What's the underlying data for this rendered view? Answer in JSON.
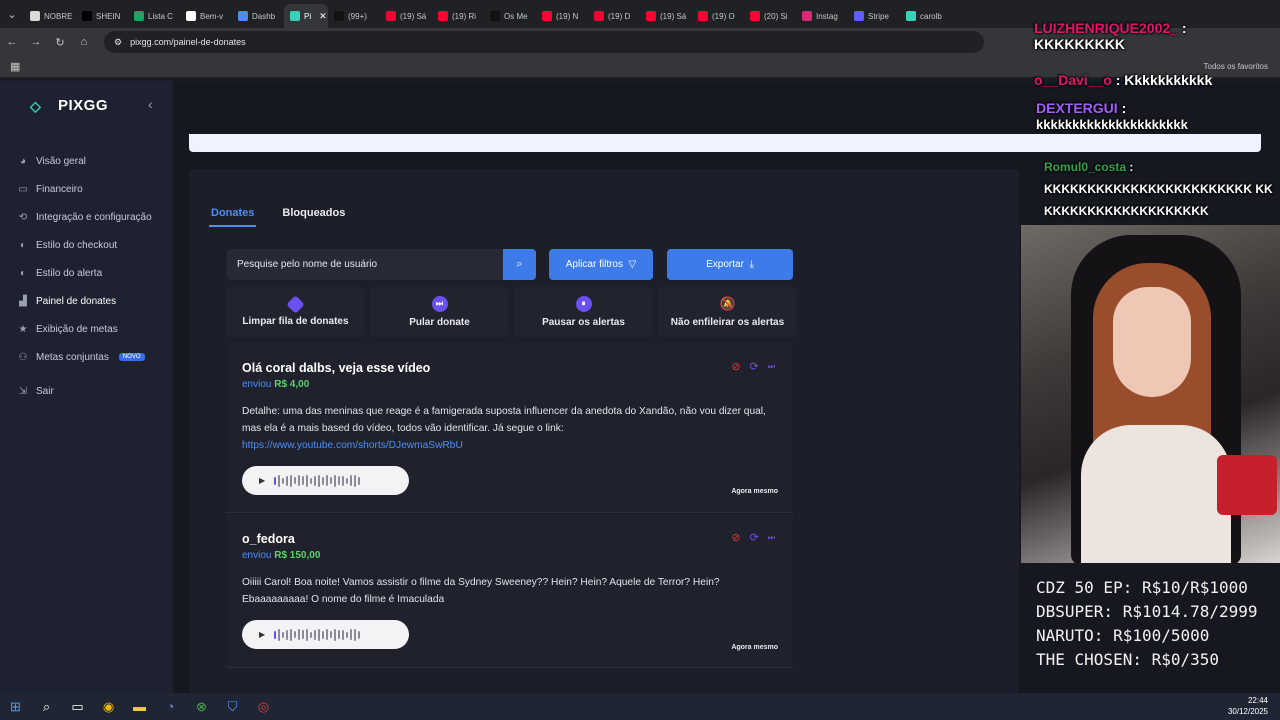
{
  "browser": {
    "tabs": [
      {
        "label": "NOBRE",
        "color": "#d9d9d9"
      },
      {
        "label": "SHEIN",
        "color": "#000000"
      },
      {
        "label": "Lista C",
        "color": "#1fa463"
      },
      {
        "label": "Bem-v",
        "color": "#ffffff"
      },
      {
        "label": "Dashb",
        "color": "#4f8df5"
      },
      {
        "label": "Pi",
        "color": "#3ad1b9",
        "active": true
      },
      {
        "label": "(99+)",
        "color": "#111111"
      },
      {
        "label": "(19) Sá",
        "color": "#ff0033"
      },
      {
        "label": "(19) Ri",
        "color": "#ff0033"
      },
      {
        "label": "Os Me",
        "color": "#111111"
      },
      {
        "label": "(19) N",
        "color": "#ff0033"
      },
      {
        "label": "(19) D",
        "color": "#ff0033"
      },
      {
        "label": "(19) Sá",
        "color": "#ff0033"
      },
      {
        "label": "(19) O",
        "color": "#ff0033"
      },
      {
        "label": "(20) Si",
        "color": "#ff0033"
      },
      {
        "label": "Instag",
        "color": "#d62976"
      },
      {
        "label": "Stripe",
        "color": "#635bff"
      },
      {
        "label": "carolb",
        "color": "#3ad1b9"
      }
    ],
    "url": "pixgg.com/painel-de-donates",
    "favorites_label": "Todos os favoritos"
  },
  "sidebar": {
    "logo": "PIXGG",
    "items": [
      {
        "label": "Visão geral",
        "icon": "dashboard-icon"
      },
      {
        "label": "Financeiro",
        "icon": "wallet-icon"
      },
      {
        "label": "Integração e configuração",
        "icon": "plug-icon"
      },
      {
        "label": "Estilo do checkout",
        "icon": "palette-icon"
      },
      {
        "label": "Estilo do alerta",
        "icon": "palette-icon"
      },
      {
        "label": "Painel de donates",
        "icon": "chart-icon",
        "active": true
      },
      {
        "label": "Exibição de metas",
        "icon": "star-icon"
      },
      {
        "label": "Metas conjuntas",
        "icon": "group-icon",
        "badge": "NOVO"
      },
      {
        "label": "Sair",
        "icon": "logout-icon"
      }
    ]
  },
  "main": {
    "tabs": [
      {
        "label": "Donates",
        "active": true
      },
      {
        "label": "Bloqueados"
      }
    ],
    "search_placeholder": "Pesquise pelo nome de usuário",
    "filter_label": "Aplicar filtros",
    "export_label": "Exportar",
    "actions": [
      {
        "label": "Limpar fila de donates",
        "icon": "eraser-icon"
      },
      {
        "label": "Pular donate",
        "icon": "skip-icon"
      },
      {
        "label": "Pausar os alertas",
        "icon": "pause-icon"
      },
      {
        "label": "Não enfileirar os alertas",
        "icon": "bell-off-icon"
      }
    ],
    "donations": [
      {
        "title": "Olá coral dalbs, veja esse vídeo",
        "sent_label": "enviou",
        "amount": "R$ 4,00",
        "message": "Detalhe: uma das meninas que reage é a famigerada suposta influencer da anedota do Xandão, não vou dizer qual, mas ela é a mais based do vídeo, todos vão identificar. Já segue o link:",
        "link": "https://www.youtube.com/shorts/DJewmaSwRbU",
        "time": "Agora mesmo"
      },
      {
        "title": "o_fedora",
        "sent_label": "enviou",
        "amount": "R$ 150,00",
        "message": "Oiiiii Carol! Boa noite! Vamos assistir o filme da Sydney Sweeney?? Hein? Hein? Aquele de Terror? Hein? Ebaaaaaaaaa! O nome do filme é Imaculada",
        "time": "Agora mesmo"
      }
    ]
  },
  "overlay": {
    "chat": [
      {
        "user": "LUIZHENRIQUE2002_",
        "text": "KKKKKKKKK",
        "color": "#e0156b"
      },
      {
        "user": "o__Davi__o",
        "text": "Kkkkkkkkkkk",
        "color": "#e0156b"
      },
      {
        "user": "DEXTERGUI",
        "text": "kkkkkkkkkkkkkkkkkkkkk",
        "color": "#a35cff"
      },
      {
        "user": "Romul0_costa",
        "text": "KKKKKKKKKKKKKKKKKKKKKKKK KKKKKKKKKKKKKKKKKKKKK",
        "color": "#2fa34a"
      }
    ],
    "goals": [
      "CDZ 50 EP: R$10/R$1000",
      "DBSUPER: R$1014.78/2999",
      "NARUTO: R$100/5000",
      "THE CHOSEN: R$0/350"
    ]
  },
  "taskbar": {
    "time": "22:44",
    "date": "30/12/2025"
  }
}
